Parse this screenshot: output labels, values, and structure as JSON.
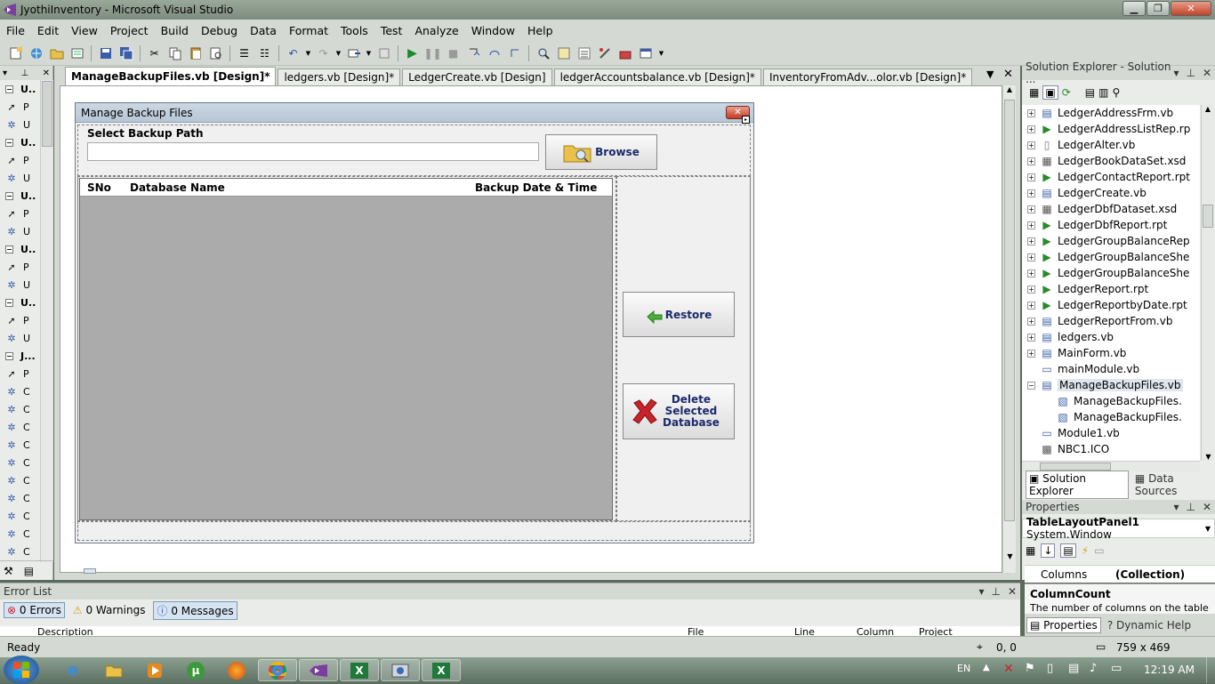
{
  "window": {
    "title": "JyothiInventory - Microsoft Visual Studio"
  },
  "menu": [
    "File",
    "Edit",
    "View",
    "Project",
    "Build",
    "Debug",
    "Data",
    "Format",
    "Tools",
    "Test",
    "Analyze",
    "Window",
    "Help"
  ],
  "toolbox": {
    "items": [
      {
        "kind": "group",
        "label": "U.."
      },
      {
        "kind": "item",
        "icon": "pointer-icon",
        "label": "P"
      },
      {
        "kind": "item",
        "icon": "gear-icon",
        "label": "U"
      },
      {
        "kind": "group",
        "label": "U.."
      },
      {
        "kind": "item",
        "icon": "pointer-icon",
        "label": "P"
      },
      {
        "kind": "item",
        "icon": "gear-icon",
        "label": "U"
      },
      {
        "kind": "group",
        "label": "U.."
      },
      {
        "kind": "item",
        "icon": "pointer-icon",
        "label": "P"
      },
      {
        "kind": "item",
        "icon": "gear-icon",
        "label": "U"
      },
      {
        "kind": "group",
        "label": "U.."
      },
      {
        "kind": "item",
        "icon": "pointer-icon",
        "label": "P"
      },
      {
        "kind": "item",
        "icon": "gear-icon",
        "label": "U"
      },
      {
        "kind": "group",
        "label": "U.."
      },
      {
        "kind": "item",
        "icon": "pointer-icon",
        "label": "P"
      },
      {
        "kind": "item",
        "icon": "gear-icon",
        "label": "U"
      },
      {
        "kind": "group",
        "label": "J..."
      },
      {
        "kind": "item",
        "icon": "pointer-icon",
        "label": "P"
      },
      {
        "kind": "item",
        "icon": "gear-icon",
        "label": "C"
      },
      {
        "kind": "item",
        "icon": "gear-icon",
        "label": "C"
      },
      {
        "kind": "item",
        "icon": "gear-icon",
        "label": "C"
      },
      {
        "kind": "item",
        "icon": "gear-icon",
        "label": "C"
      },
      {
        "kind": "item",
        "icon": "gear-icon",
        "label": "C"
      },
      {
        "kind": "item",
        "icon": "gear-icon",
        "label": "C"
      },
      {
        "kind": "item",
        "icon": "gear-icon",
        "label": "C"
      },
      {
        "kind": "item",
        "icon": "gear-icon",
        "label": "C"
      },
      {
        "kind": "item",
        "icon": "gear-icon",
        "label": "C"
      },
      {
        "kind": "item",
        "icon": "gear-icon",
        "label": "C"
      }
    ]
  },
  "tabs": [
    {
      "label": "ManageBackupFiles.vb [Design]*",
      "active": true
    },
    {
      "label": "ledgers.vb [Design]*",
      "active": false
    },
    {
      "label": "LedgerCreate.vb [Design]",
      "active": false
    },
    {
      "label": "ledgerAccountsbalance.vb [Design]*",
      "active": false
    },
    {
      "label": "InventoryFromAdv...olor.vb [Design]*",
      "active": false
    }
  ],
  "form": {
    "title": "Manage Backup Files",
    "select_path_label": "Select Backup Path",
    "path_value": "",
    "browse_label": "Browse",
    "grid_columns": [
      "SNo",
      "Database Name",
      "Backup Date & Time"
    ],
    "restore_label": "Restore",
    "delete_label_1": "Delete",
    "delete_label_2": "Selected",
    "delete_label_3": "Database"
  },
  "solution_explorer": {
    "title": "Solution Explorer - Solution ...",
    "items": [
      {
        "label": "LedgerAddressFrm.vb",
        "icon": "form-icon",
        "expand": true,
        "indent": 0
      },
      {
        "label": "LedgerAddressListRep.rp",
        "icon": "report-icon",
        "expand": true,
        "indent": 0
      },
      {
        "label": "LedgerAlter.vb",
        "icon": "file-icon",
        "expand": true,
        "indent": 0
      },
      {
        "label": "LedgerBookDataSet.xsd",
        "icon": "dataset-icon",
        "expand": true,
        "indent": 0
      },
      {
        "label": "LedgerContactReport.rpt",
        "icon": "report-icon",
        "expand": true,
        "indent": 0
      },
      {
        "label": "LedgerCreate.vb",
        "icon": "form-icon",
        "expand": true,
        "indent": 0
      },
      {
        "label": "LedgerDbfDataset.xsd",
        "icon": "dataset-icon",
        "expand": true,
        "indent": 0
      },
      {
        "label": "LedgerDbfReport.rpt",
        "icon": "report-icon",
        "expand": true,
        "indent": 0
      },
      {
        "label": "LedgerGroupBalanceRep",
        "icon": "report-icon",
        "expand": true,
        "indent": 0
      },
      {
        "label": "LedgerGroupBalanceShe",
        "icon": "report-icon",
        "expand": true,
        "indent": 0
      },
      {
        "label": "LedgerGroupBalanceShe",
        "icon": "report-icon",
        "expand": true,
        "indent": 0
      },
      {
        "label": "LedgerReport.rpt",
        "icon": "report-icon",
        "expand": true,
        "indent": 0
      },
      {
        "label": "LedgerReportbyDate.rpt",
        "icon": "report-icon",
        "expand": true,
        "indent": 0
      },
      {
        "label": "LedgerReportFrom.vb",
        "icon": "form-icon",
        "expand": true,
        "indent": 0
      },
      {
        "label": "ledgers.vb",
        "icon": "form-icon",
        "expand": true,
        "indent": 0
      },
      {
        "label": "MainForm.vb",
        "icon": "form-icon",
        "expand": true,
        "indent": 0
      },
      {
        "label": "mainModule.vb",
        "icon": "module-icon",
        "expand": false,
        "indent": 0
      },
      {
        "label": "ManageBackupFiles.vb",
        "icon": "form-icon",
        "expand": "open",
        "indent": 0
      },
      {
        "label": "ManageBackupFiles.",
        "icon": "designer-file-icon",
        "expand": false,
        "indent": 1
      },
      {
        "label": "ManageBackupFiles.",
        "icon": "designer-file-icon",
        "expand": false,
        "indent": 1
      },
      {
        "label": "Module1.vb",
        "icon": "module-icon",
        "expand": false,
        "indent": 0
      },
      {
        "label": "NBC1.ICO",
        "icon": "ico-file-icon",
        "expand": false,
        "indent": 0
      }
    ],
    "tab_solution": "Solution Explorer",
    "tab_data": "Data Sources"
  },
  "properties": {
    "title": "Properties",
    "object_name": "TableLayoutPanel1",
    "object_type": "System.Window",
    "prop_name": "Columns",
    "prop_value": "(Collection)",
    "desc_title": "ColumnCount",
    "desc_text": "The number of columns on the table",
    "tab_properties": "Properties",
    "tab_help": "Dynamic Help"
  },
  "error_list": {
    "title": "Error List",
    "errors": "0 Errors",
    "warnings": "0 Warnings",
    "messages": "0 Messages",
    "cols": [
      "Description",
      "File",
      "Line",
      "Column",
      "Project"
    ]
  },
  "status": {
    "ready": "Ready",
    "pos": "0, 0",
    "size": "759 x 469"
  },
  "taskbar": {
    "lang": "EN",
    "time": "12:19 AM"
  }
}
